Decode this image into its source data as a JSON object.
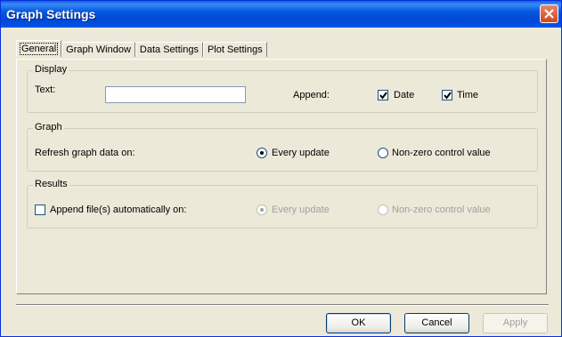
{
  "window": {
    "title": "Graph Settings"
  },
  "tabs": [
    {
      "label": "General"
    },
    {
      "label": "Graph Window"
    },
    {
      "label": "Data Settings"
    },
    {
      "label": "Plot Settings"
    }
  ],
  "display": {
    "legend": "Display",
    "text_label": "Text:",
    "text_value": "",
    "append_label": "Append:",
    "date_label": "Date",
    "date_checked": true,
    "time_label": "Time",
    "time_checked": true
  },
  "graph": {
    "legend": "Graph",
    "refresh_label": "Refresh graph data on:",
    "option_every": "Every update",
    "option_nonzero": "Non-zero control value",
    "selected": "Every update"
  },
  "results": {
    "legend": "Results",
    "append_label": "Append file(s) automatically on:",
    "append_checked": false,
    "option_every": "Every update",
    "option_nonzero": "Non-zero control value",
    "selected": "Every update"
  },
  "buttons": {
    "ok": "OK",
    "cancel": "Cancel",
    "apply": "Apply"
  }
}
